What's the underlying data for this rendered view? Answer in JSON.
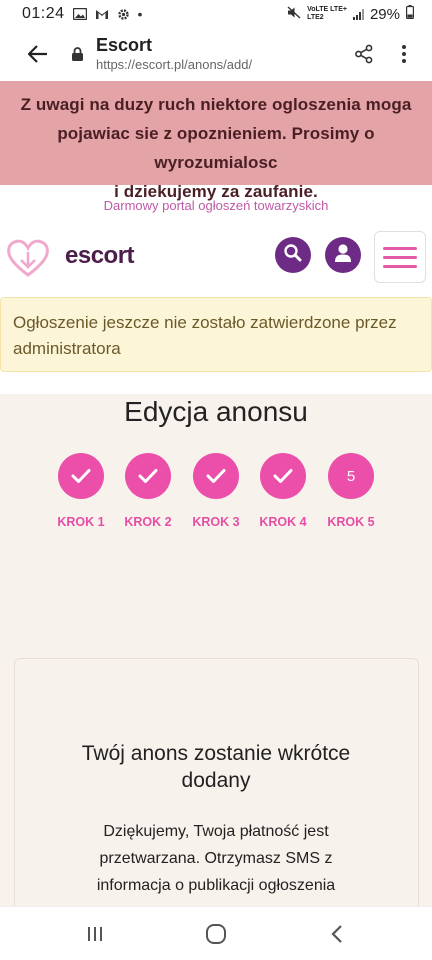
{
  "status": {
    "time": "01:24",
    "dot": "•",
    "net_line1": "VoLTE LTE+",
    "net_line2": "LTE2",
    "battery": "29%"
  },
  "browser": {
    "title": "Escort",
    "url": "https://escort.pl/anons/add/"
  },
  "notice": {
    "line1": "Z uwagi na duzy ruch niektore ogloszenia moga",
    "line2": "pojawiac sie z opoznieniem. Prosimy o wyrozumialosc",
    "line3": "i dziekujemy za zaufanie."
  },
  "tagline": "Darmowy portal ogłoszeń towarzyskich",
  "logo": {
    "text": "escort"
  },
  "alert": {
    "line1": "Ogłoszenie jeszcze nie zostało zatwierdzone przez",
    "line2": "administratora"
  },
  "page_title": "Edycja anonsu",
  "steps": [
    {
      "label": "KROK 1",
      "state": "done"
    },
    {
      "label": "KROK 2",
      "state": "done"
    },
    {
      "label": "KROK 3",
      "state": "done"
    },
    {
      "label": "KROK 4",
      "state": "done"
    },
    {
      "label": "KROK 5",
      "state": "current",
      "number": "5"
    }
  ],
  "card": {
    "title_line1": "Twój anons zostanie wkrótce",
    "title_line2": "dodany",
    "text_line1": "Dziękujemy, Twoja płatność jest",
    "text_line2": "przetwarzana. Otrzymasz SMS z",
    "text_line3": "informacja o publikacji ogłoszenia"
  },
  "colors": {
    "notice_bg": "#e3a3a7",
    "brand_purple": "#6e2b86",
    "brand_pink": "#ec4fa9",
    "alert_bg": "#fdf5d7",
    "page_bg": "#f8f2ec"
  },
  "icons": [
    "gallery-icon",
    "gmail-icon",
    "settings-icon",
    "mute-icon",
    "signal-icon",
    "battery-icon",
    "back-arrow-icon",
    "lock-icon",
    "share-icon",
    "more-vert-icon",
    "heart-logo-icon",
    "search-icon",
    "user-icon",
    "hamburger-icon",
    "check-icon",
    "recents-icon",
    "home-icon",
    "nav-back-icon"
  ]
}
